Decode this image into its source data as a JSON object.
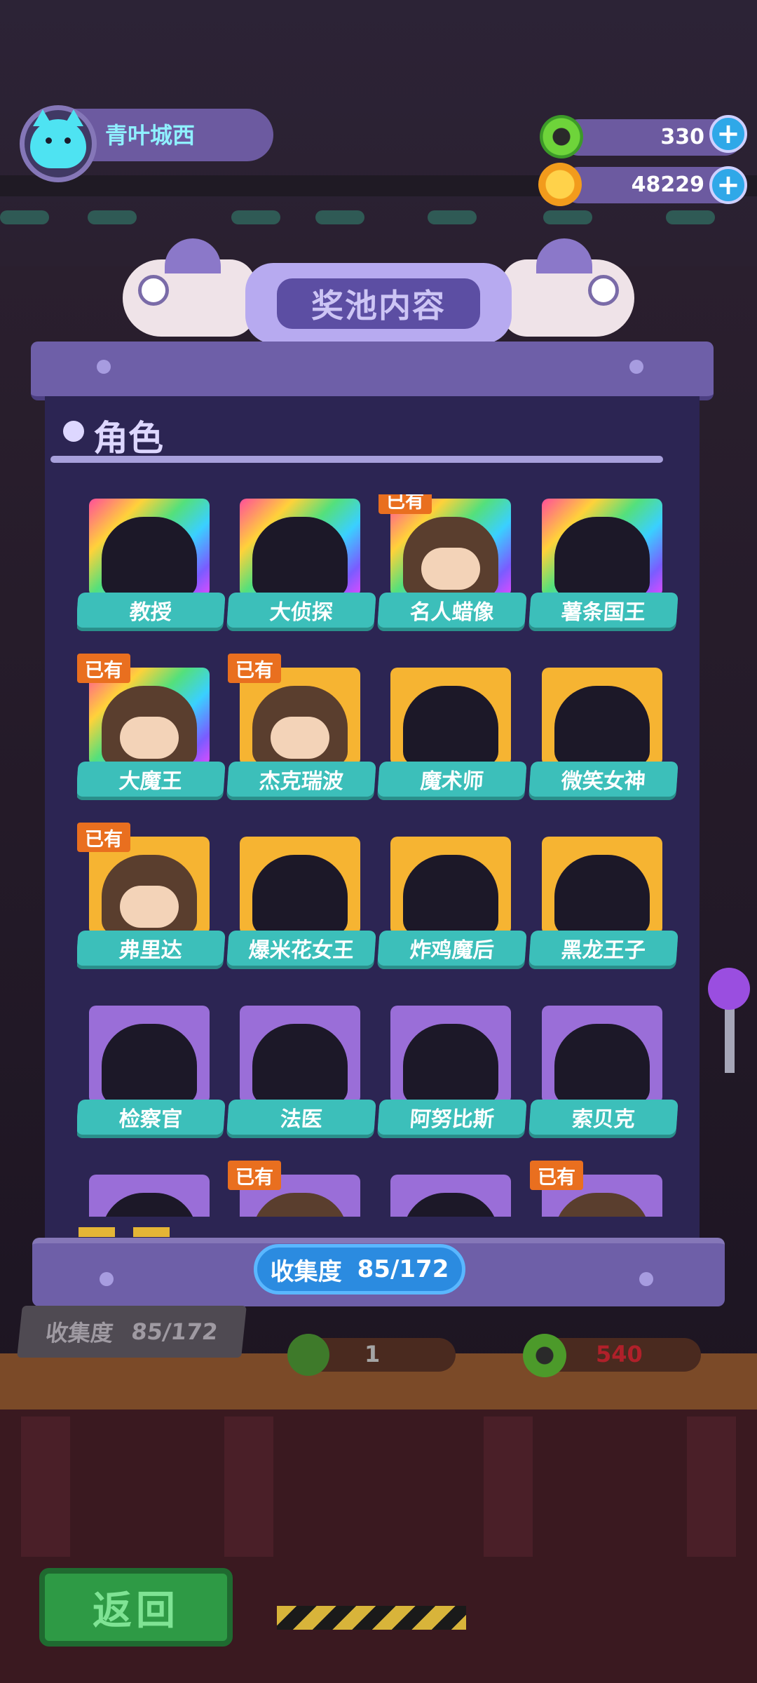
{
  "player": {
    "name": "青叶城西"
  },
  "currencies": [
    {
      "icon": "green-donut-coin-icon",
      "value": "330"
    },
    {
      "icon": "orange-planet-coin-icon",
      "value": "48229"
    }
  ],
  "banner": {
    "title": "奖池内容"
  },
  "section": {
    "title": "角色"
  },
  "owned_badge": "已有",
  "characters": [
    {
      "name": "教授",
      "frame": "rainbow",
      "owned": false
    },
    {
      "name": "大侦探",
      "frame": "rainbow",
      "owned": false
    },
    {
      "name": "名人蜡像",
      "frame": "rainbow",
      "owned": true
    },
    {
      "name": "薯条国王",
      "frame": "rainbow",
      "owned": false
    },
    {
      "name": "大魔王",
      "frame": "rainbow",
      "owned": true
    },
    {
      "name": "杰克瑞波",
      "frame": "gold",
      "owned": true
    },
    {
      "name": "魔术师",
      "frame": "gold",
      "owned": false
    },
    {
      "name": "微笑女神",
      "frame": "gold",
      "owned": false
    },
    {
      "name": "弗里达",
      "frame": "gold",
      "owned": true
    },
    {
      "name": "爆米花女王",
      "frame": "gold",
      "owned": false
    },
    {
      "name": "炸鸡魔后",
      "frame": "gold",
      "owned": false
    },
    {
      "name": "黑龙王子",
      "frame": "gold",
      "owned": false
    },
    {
      "name": "检察官",
      "frame": "purple",
      "owned": false
    },
    {
      "name": "法医",
      "frame": "purple",
      "owned": false
    },
    {
      "name": "阿努比斯",
      "frame": "purple",
      "owned": false
    },
    {
      "name": "索贝克",
      "frame": "purple",
      "owned": false
    },
    {
      "name": "",
      "frame": "purple",
      "owned": false
    },
    {
      "name": "",
      "frame": "purple",
      "owned": true
    },
    {
      "name": "",
      "frame": "purple",
      "owned": false
    },
    {
      "name": "",
      "frame": "purple",
      "owned": true
    }
  ],
  "collection": {
    "label": "收集度",
    "value": "85/172"
  },
  "background": {
    "collection_label": "收集度",
    "collection_value": "85/172",
    "ticket_count": "1",
    "donut_cost": "540",
    "back_button": "返回"
  }
}
